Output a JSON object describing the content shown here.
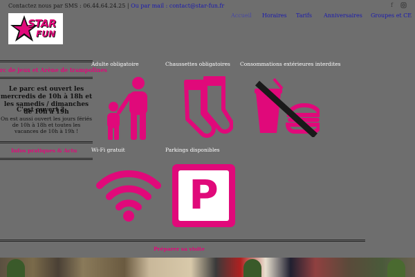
{
  "header": {
    "contact_sms": "Contactez nous par SMS : 06.44.64.24.25 |",
    "contact_mail": "Ou par mail : contact@star-fun.fr",
    "social": [
      "facebook-icon",
      "instagram-icon"
    ],
    "logo_text_1": "STAR",
    "logo_text_2": "FUN"
  },
  "nav": {
    "items": [
      "Accueil",
      "Horaires",
      "Tarifs",
      "Anniversaires",
      "Groupes et CE"
    ],
    "active": "Accueil"
  },
  "sidebar": {
    "title": "rc de jeux et Arène de trampolines",
    "hours": "Le parc est ouvert les mercredis de 10h à 18h et les samedis / dimanches de 10h à 19h",
    "overlay_question": "C'est ouvert ?",
    "holiday": "On est aussi ouvert les jours fériés de 10h à 18h et toutes les vacances de 10h à 19h !",
    "infos": "Infos pratiques & Actu"
  },
  "rules": {
    "adult": "Adulte obligatoire",
    "socks": "Chaussettes obligatoires",
    "no_food": "Consommations extérieures interdites",
    "wifi": "Wi-Fi gratuit",
    "parking": "Parkings disponibles",
    "parking_letter": "P"
  },
  "footer": {
    "visit": "Préparer sa visite"
  },
  "colors": {
    "accent": "#e0097a",
    "background": "#6e6e6e",
    "link": "#1a1ab0"
  }
}
